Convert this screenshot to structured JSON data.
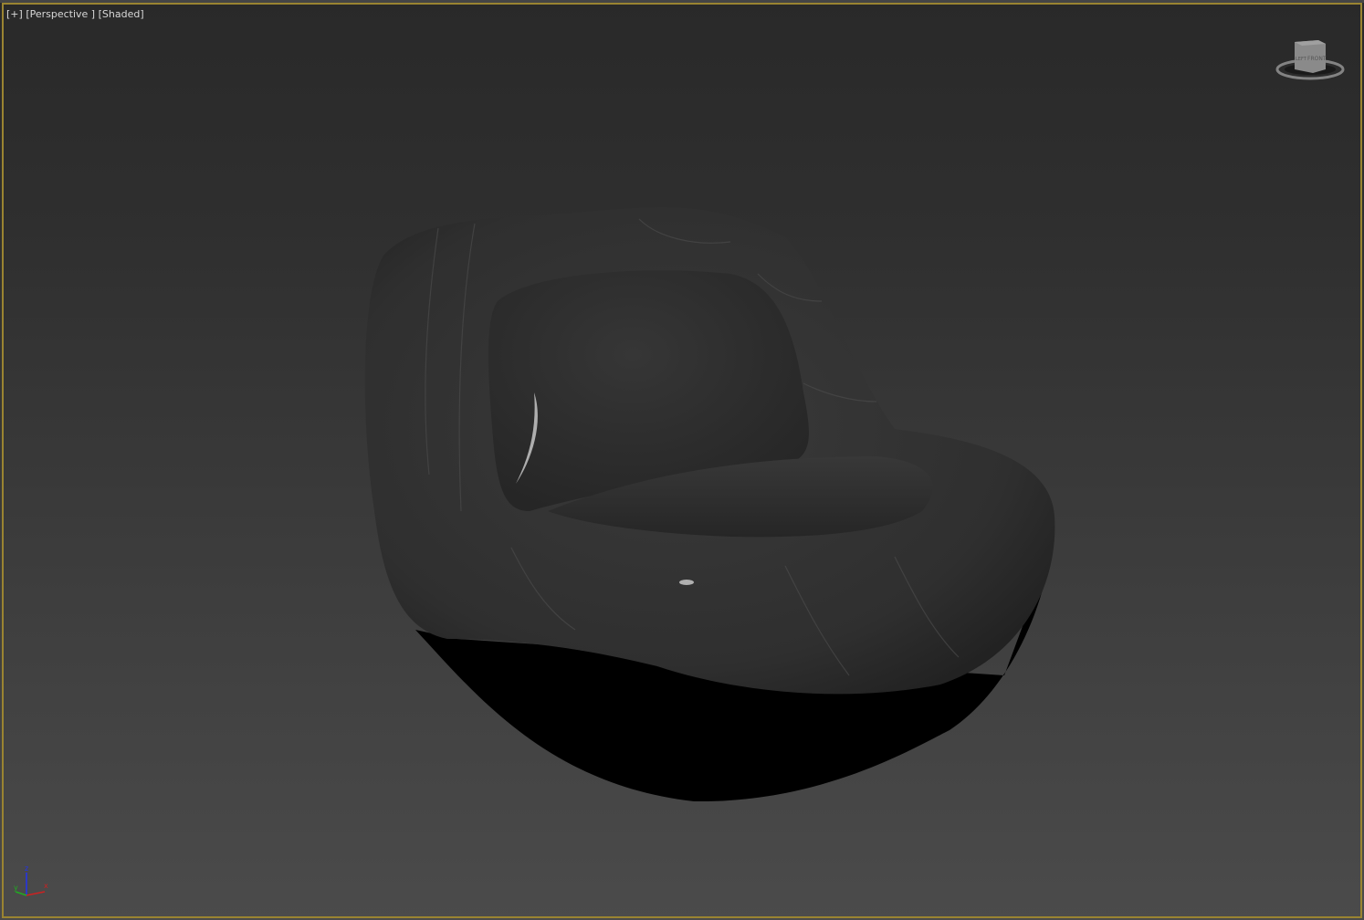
{
  "viewport": {
    "menu_label": "[+]",
    "view_label": "[Perspective ]",
    "shading_label": "[Shaded]",
    "border_color": "#9a8431",
    "viewcube": {
      "face_label": "FRONT",
      "side_label": "LEFT"
    },
    "axis_gizmo": {
      "x": "x",
      "y": "y",
      "z": "z",
      "x_color": "#cc2222",
      "y_color": "#22aa22",
      "z_color": "#2233ee"
    }
  }
}
